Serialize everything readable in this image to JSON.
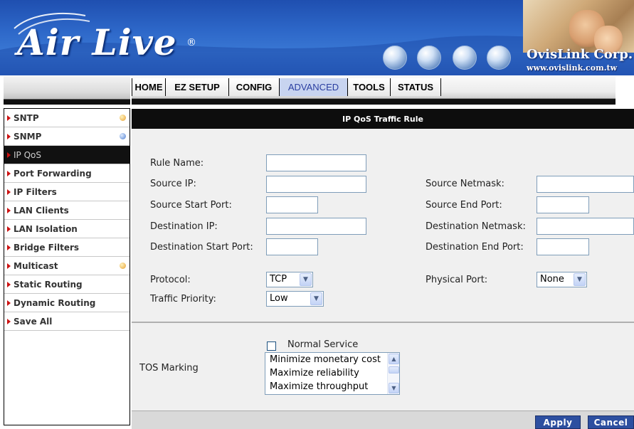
{
  "header": {
    "logo_text": "Air Live",
    "logo_reg": "®",
    "company_name": "OvisLink Corp.",
    "company_url": "www.ovislink.com.tw"
  },
  "nav": {
    "items": [
      "HOME",
      "EZ SETUP",
      "CONFIG",
      "ADVANCED",
      "TOOLS",
      "STATUS"
    ],
    "active": "ADVANCED"
  },
  "sidebar": {
    "items": [
      {
        "label": "SNTP",
        "badge": "orange"
      },
      {
        "label": "SNMP",
        "badge": "blue"
      },
      {
        "label": "IP QoS",
        "active": true
      },
      {
        "label": "Port Forwarding"
      },
      {
        "label": "IP Filters"
      },
      {
        "label": "LAN Clients"
      },
      {
        "label": "LAN Isolation"
      },
      {
        "label": "Bridge Filters"
      },
      {
        "label": "Multicast",
        "badge": "orange"
      },
      {
        "label": "Static Routing"
      },
      {
        "label": "Dynamic Routing"
      },
      {
        "label": "Save All"
      }
    ]
  },
  "main": {
    "title": "IP QoS Traffic Rule",
    "rule_name_label": "Rule Name:",
    "source_ip_label": "Source IP:",
    "source_netmask_label": "Source Netmask:",
    "source_start_port_label": "Source Start Port:",
    "source_end_port_label": "Source End Port:",
    "destination_ip_label": "Destination IP:",
    "destination_netmask_label": "Destination Netmask:",
    "destination_start_port_label": "Destination Start Port:",
    "destination_end_port_label": "Destination End Port:",
    "protocol_label": "Protocol:",
    "protocol_value": "TCP",
    "physical_port_label": "Physical Port:",
    "physical_port_value": "None",
    "traffic_priority_label": "Traffic Priority:",
    "traffic_priority_value": "Low",
    "normal_service_label": "Normal Service",
    "tos_marking_label": "TOS Marking",
    "tos_options": [
      "Minimize monetary cost",
      "Maximize reliability",
      "Maximize throughput"
    ],
    "apply_label": "Apply",
    "cancel_label": "Cancel"
  },
  "colors": {
    "banner": "#2d67c8",
    "active_tab": "#c8d4f0",
    "header_bar": "#0d0d0d",
    "button": "#2d4fa0",
    "sidebar_arrow": "#cc1111"
  }
}
